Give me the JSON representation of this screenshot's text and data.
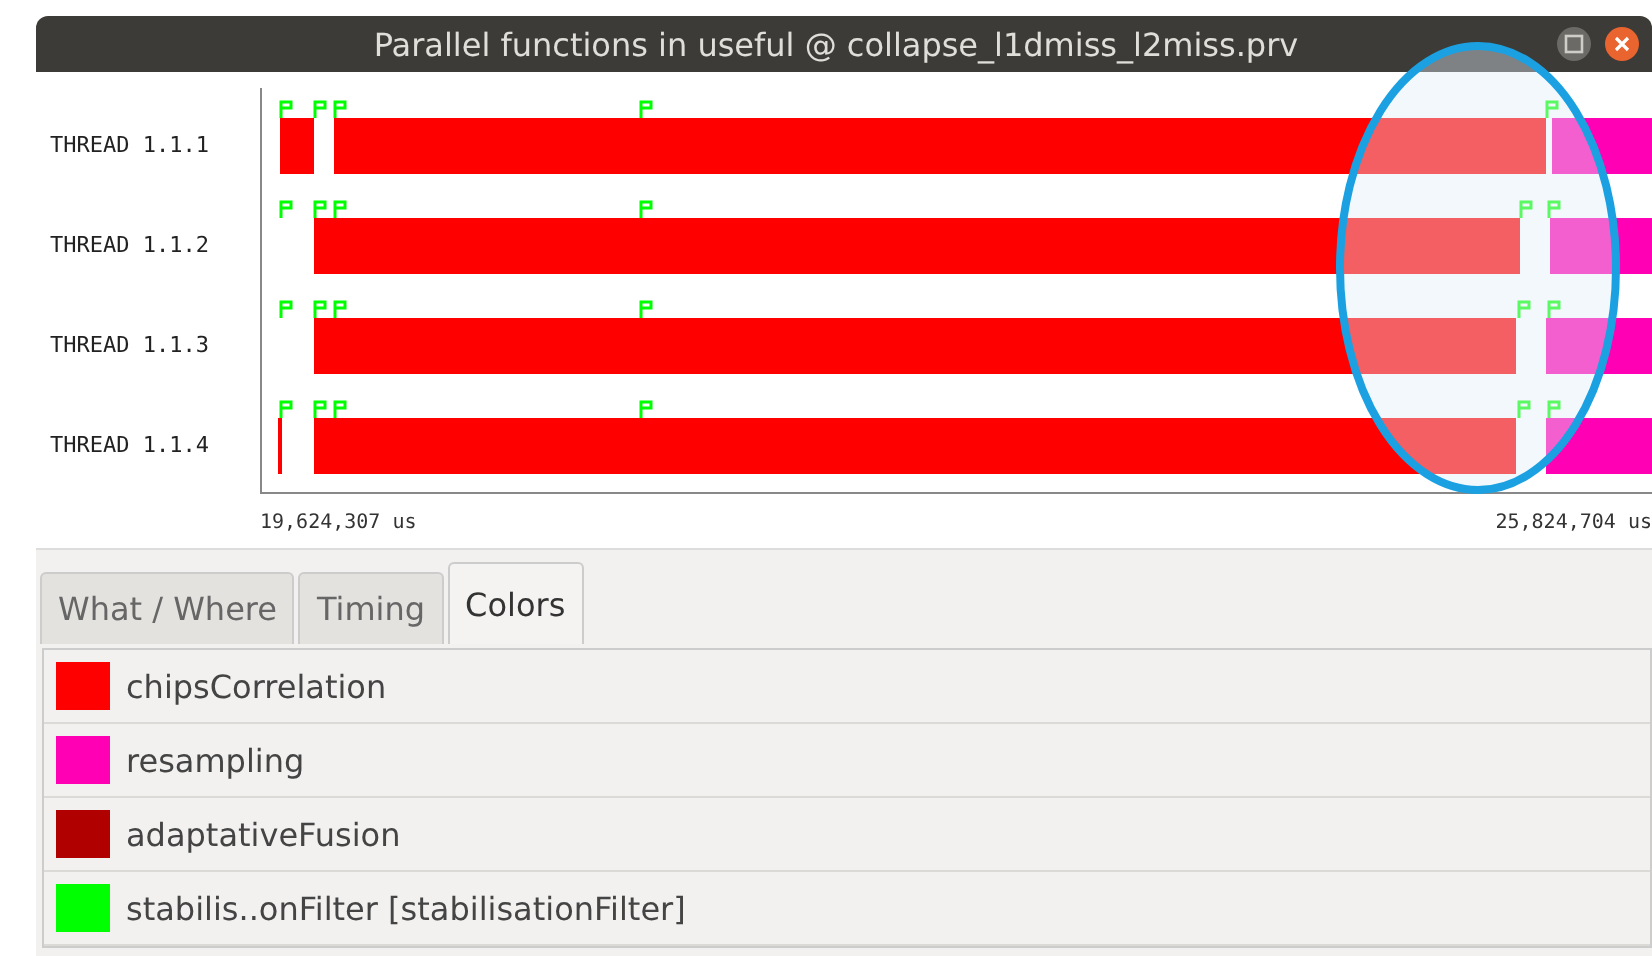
{
  "window": {
    "title": "Parallel functions in useful @ collapse_l1dmiss_l2miss.prv"
  },
  "threads": [
    {
      "label": "THREAD 1.1.1"
    },
    {
      "label": "THREAD 1.1.2"
    },
    {
      "label": "THREAD 1.1.3"
    },
    {
      "label": "THREAD 1.1.4"
    }
  ],
  "axis": {
    "start_label": "19,624,307 us",
    "end_label": "25,824,704 us"
  },
  "tabs": [
    {
      "label": "What / Where",
      "selected": false
    },
    {
      "label": "Timing",
      "selected": false
    },
    {
      "label": "Colors",
      "selected": true
    }
  ],
  "legend": [
    {
      "name": "chipsCorrelation",
      "color": "#ff0000"
    },
    {
      "name": "resampling",
      "color": "#ff00b4"
    },
    {
      "name": "adaptativeFusion",
      "color": "#b00000"
    },
    {
      "name": "stabilis..onFilter [stabilisationFilter]",
      "color": "#00ff00"
    }
  ]
}
